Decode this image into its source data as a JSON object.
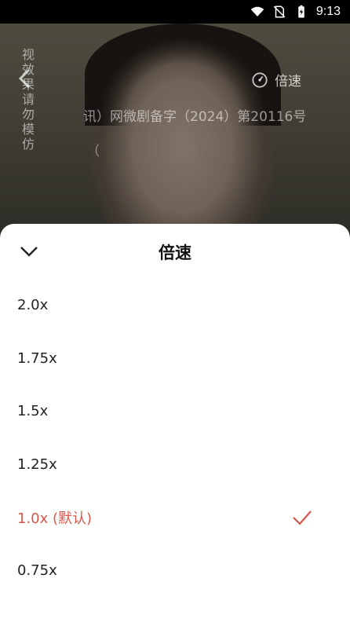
{
  "status_bar": {
    "time": "9:13",
    "icons": [
      "wifi-icon",
      "no-sim-icon",
      "battery-charging-icon"
    ]
  },
  "video": {
    "warning_text": "视效果 请勿模仿",
    "license_text": "讯）网微剧备字（2024）第20116号",
    "license_text_line2": "（",
    "speed_button_label": "倍速"
  },
  "sheet": {
    "title": "倍速",
    "options": [
      {
        "label": "2.0x",
        "selected": false
      },
      {
        "label": "1.75x",
        "selected": false
      },
      {
        "label": "1.5x",
        "selected": false
      },
      {
        "label": "1.25x",
        "selected": false
      },
      {
        "label": "1.0x (默认)",
        "selected": true
      },
      {
        "label": "0.75x",
        "selected": false
      }
    ]
  },
  "colors": {
    "accent": "#d9574a",
    "sheet_bg": "#ffffff",
    "text": "#222222"
  }
}
